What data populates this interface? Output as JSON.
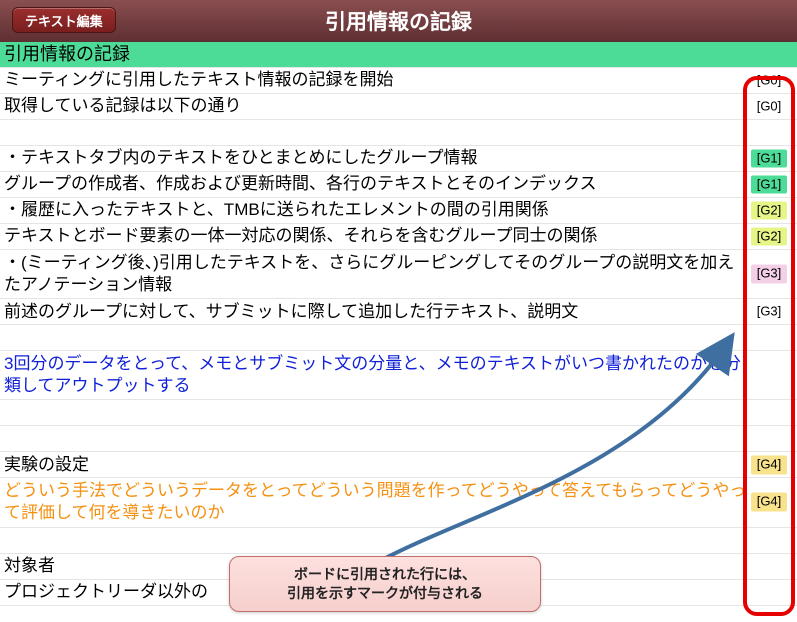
{
  "titlebar": {
    "title": "引用情報の記録",
    "edit_button": "テキスト編集"
  },
  "rows": [
    {
      "text": "引用情報の記録",
      "cls": "header",
      "tag": null,
      "tagCls": null
    },
    {
      "text": "ミーティングに引用したテキスト情報の記録を開始",
      "cls": "",
      "tag": "[G0]",
      "tagCls": ""
    },
    {
      "text": "取得している記録は以下の通り",
      "cls": "",
      "tag": "[G0]",
      "tagCls": ""
    },
    {
      "text": "",
      "cls": "",
      "tag": null,
      "tagCls": null
    },
    {
      "text": "・テキストタブ内のテキストをひとまとめにしたグループ情報",
      "cls": "",
      "tag": "[G1]",
      "tagCls": "g1"
    },
    {
      "text": " グループの作成者、作成および更新時間、各行のテキストとそのインデックス",
      "cls": "",
      "tag": "[G1]",
      "tagCls": "g1"
    },
    {
      "text": " ・履歴に入ったテキストと、TMBに送られたエレメントの間の引用関係",
      "cls": "",
      "tag": "[G2]",
      "tagCls": "g2"
    },
    {
      "text": "テキストとボード要素の一体一対応の関係、それらを含むグループ同士の関係",
      "cls": "",
      "tag": "[G2]",
      "tagCls": "g2"
    },
    {
      "text": "・(ミーティング後、)引用したテキストを、さらにグルーピングしてそのグループの説明文を加えたアノテーション情報",
      "cls": "wrap",
      "tag": "[G3]",
      "tagCls": "g3"
    },
    {
      "text": "前述のグループに対して、サブミットに際して追加した行テキスト、説明文",
      "cls": "",
      "tag": "[G3]",
      "tagCls": ""
    },
    {
      "text": "",
      "cls": "",
      "tag": null,
      "tagCls": null
    },
    {
      "text": "3回分のデータをとって、メモとサブミット文の分量と、メモのテキストがいつ書かれたのかを分類してアウトプットする",
      "cls": "blue wrap",
      "tag": null,
      "tagCls": null
    },
    {
      "text": "",
      "cls": "",
      "tag": null,
      "tagCls": null
    },
    {
      "text": "",
      "cls": "",
      "tag": null,
      "tagCls": null
    },
    {
      "text": "実験の設定",
      "cls": "",
      "tag": "[G4]",
      "tagCls": "g4"
    },
    {
      "text": "どういう手法でどういうデータをとってどういう問題を作ってどうやって答えてもらってどうやって評価して何を導きたいのか",
      "cls": "orange wrap",
      "tag": "[G4]",
      "tagCls": "g4"
    },
    {
      "text": "",
      "cls": "",
      "tag": null,
      "tagCls": null
    },
    {
      "text": "対象者",
      "cls": "",
      "tag": null,
      "tagCls": null
    },
    {
      "text": "プロジェクトリーダ以外の",
      "cls": "",
      "tag": null,
      "tagCls": null
    }
  ],
  "callout": {
    "line1": "ボードに引用された行には、",
    "line2": "引用を示すマークが付与される"
  }
}
